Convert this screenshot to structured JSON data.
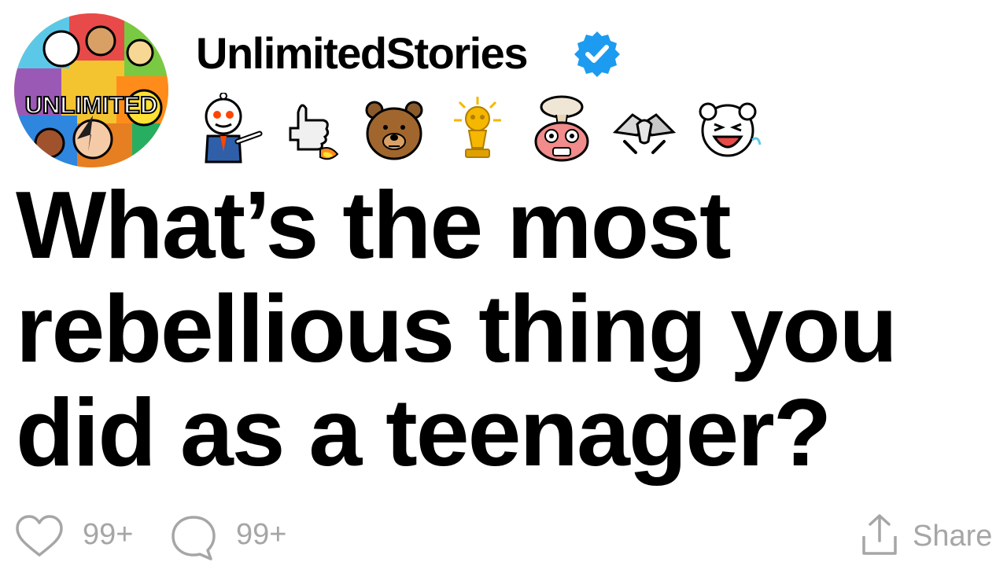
{
  "post": {
    "username": "UnlimitedStories",
    "avatar_label": "UNLIMITED",
    "title": "What’s the most rebellious thing you did as a teenager?",
    "awards": [
      "pointing-award-icon",
      "thumbs-up-rocket-award-icon",
      "bear-award-icon",
      "gold-trophy-award-icon",
      "mind-blown-award-icon",
      "handshake-award-icon",
      "laughing-award-icon"
    ]
  },
  "actions": {
    "likes": "99+",
    "comments": "99+",
    "share_label": "Share"
  },
  "colors": {
    "verified_blue": "#1d9bf0",
    "muted_gray": "#a6a6a6",
    "text": "#000000"
  }
}
